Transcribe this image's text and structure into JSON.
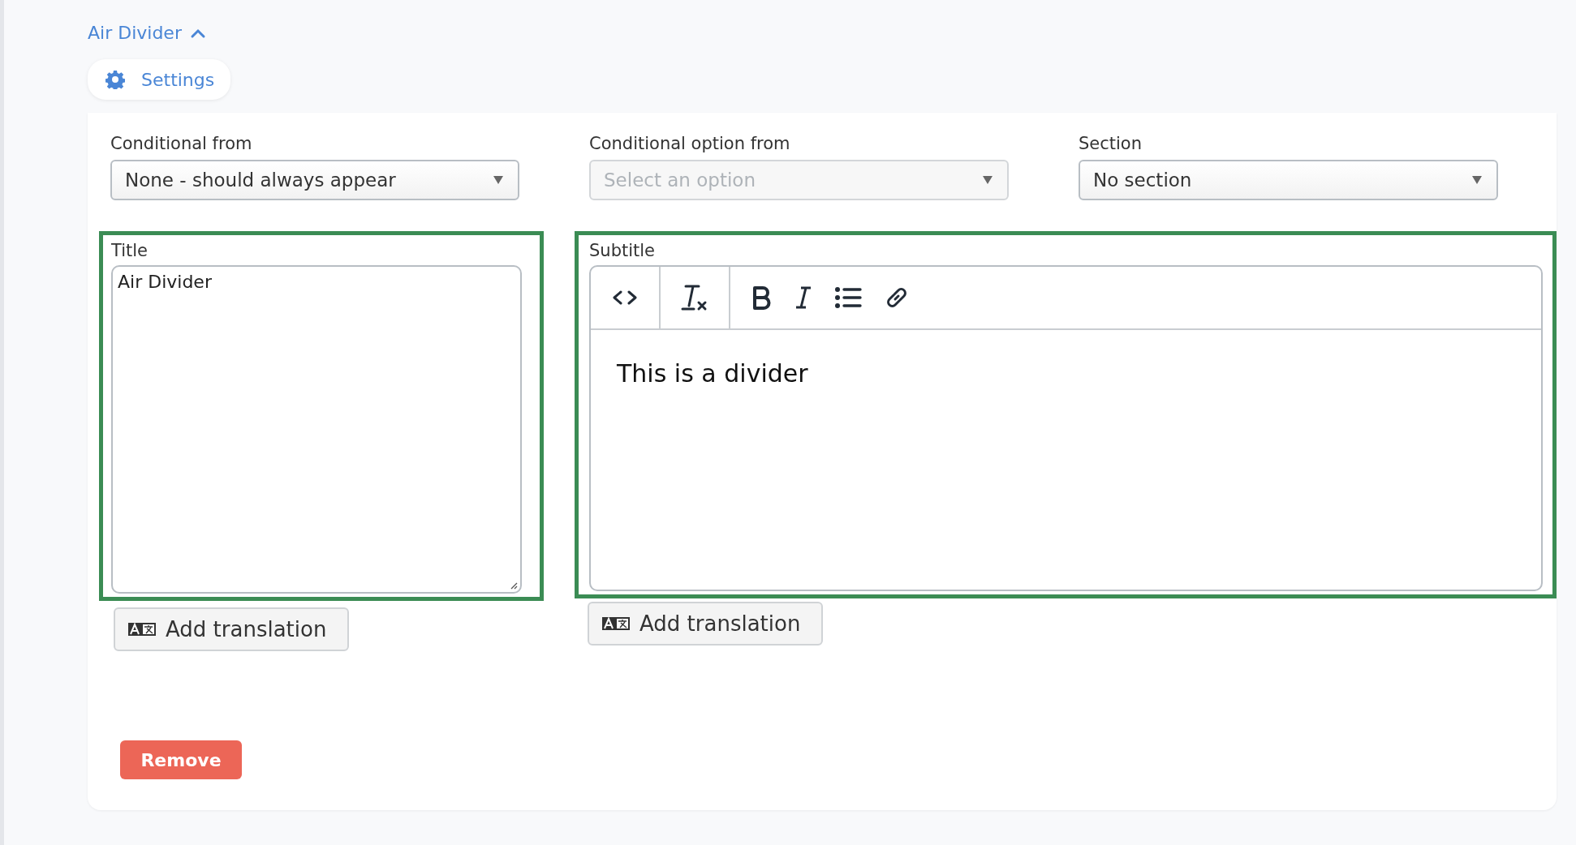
{
  "header": {
    "title": "Air Divider",
    "expanded": true
  },
  "settings_button": {
    "label": "Settings"
  },
  "selects": [
    {
      "label": "Conditional from",
      "value": "None - should always appear",
      "disabled": false
    },
    {
      "label": "Conditional option from",
      "placeholder": "Select an option",
      "disabled": true
    },
    {
      "label": "Section",
      "value": "No section",
      "disabled": false
    }
  ],
  "title_field": {
    "label": "Title",
    "value": "Air Divider",
    "highlighted": true,
    "translation_button": "Add translation"
  },
  "subtitle_field": {
    "label": "Subtitle",
    "highlighted": true,
    "toolbar": [
      {
        "kind": "code"
      },
      {
        "kind": "clear-format"
      },
      {
        "kind": "bold"
      },
      {
        "kind": "italic"
      },
      {
        "kind": "list"
      },
      {
        "kind": "link"
      }
    ],
    "value": "This is a divider",
    "translation_button": "Add translation"
  },
  "remove_button": {
    "label": "Remove"
  }
}
